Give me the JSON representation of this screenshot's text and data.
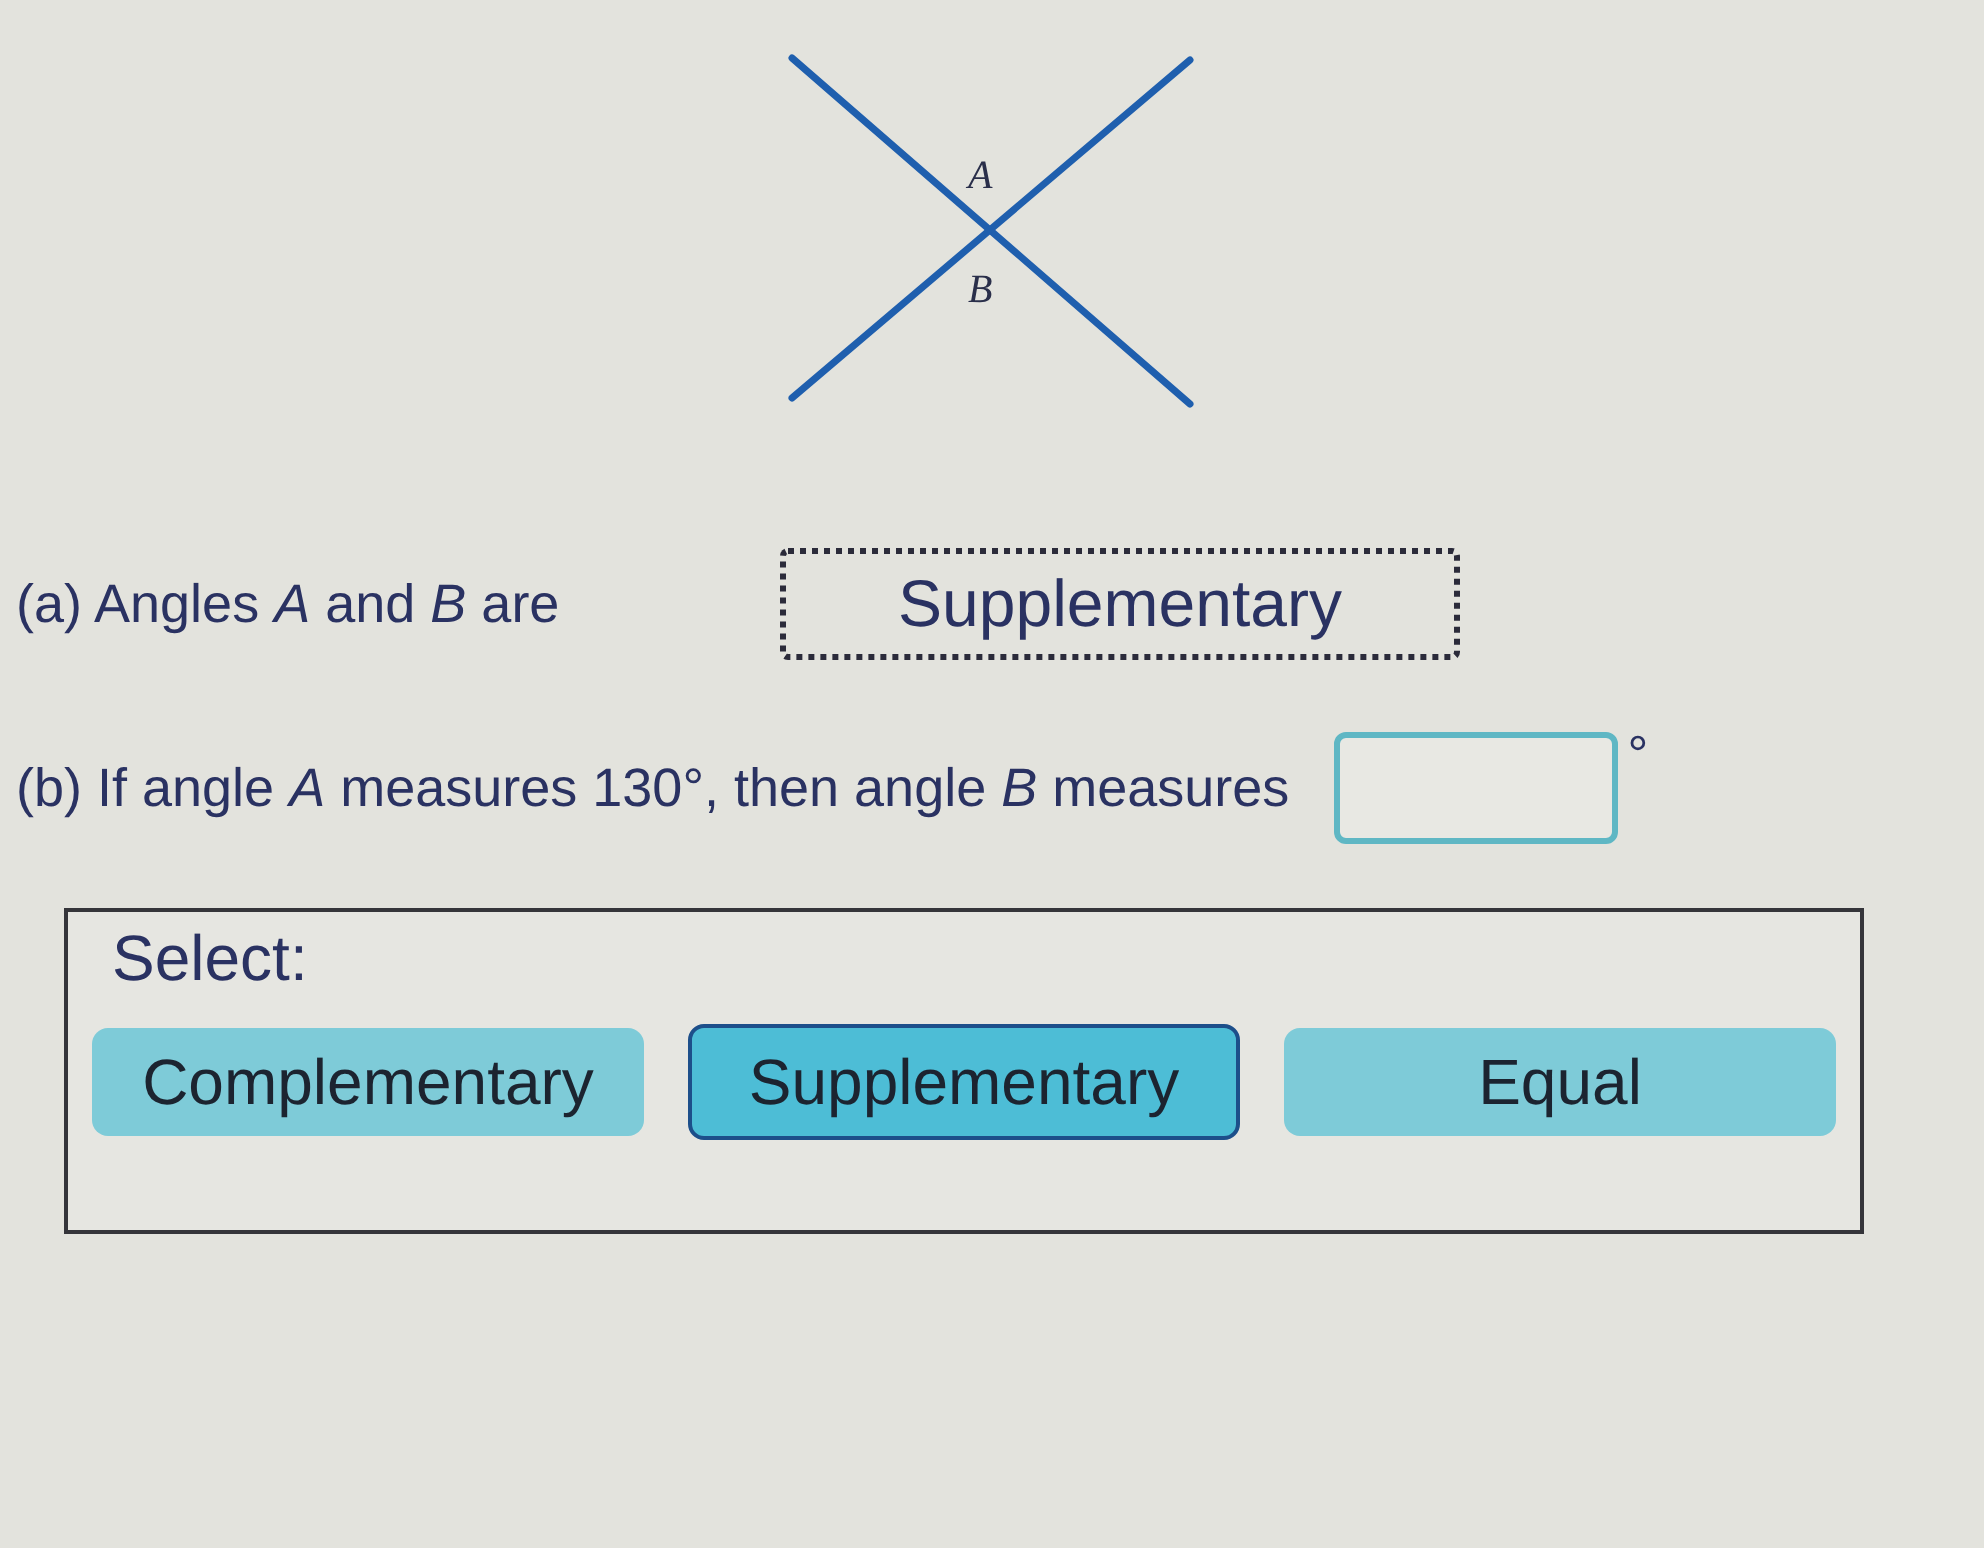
{
  "diagram": {
    "labels": [
      "A",
      "B"
    ]
  },
  "parts": [
    {
      "kind": "select",
      "prompt": "(a) Angles *A* and *B* are",
      "answer": "Supplementary"
    },
    {
      "kind": "numeric",
      "prompt": "(b) If angle *A* measures 130°, then angle *B* measures",
      "unit": "°"
    }
  ],
  "select_panel": {
    "title": "Select:",
    "options": [
      {
        "label": "Complementary",
        "selected": false
      },
      {
        "label": "Supplementary",
        "selected": true
      },
      {
        "label": "Equal",
        "selected": false
      }
    ]
  }
}
